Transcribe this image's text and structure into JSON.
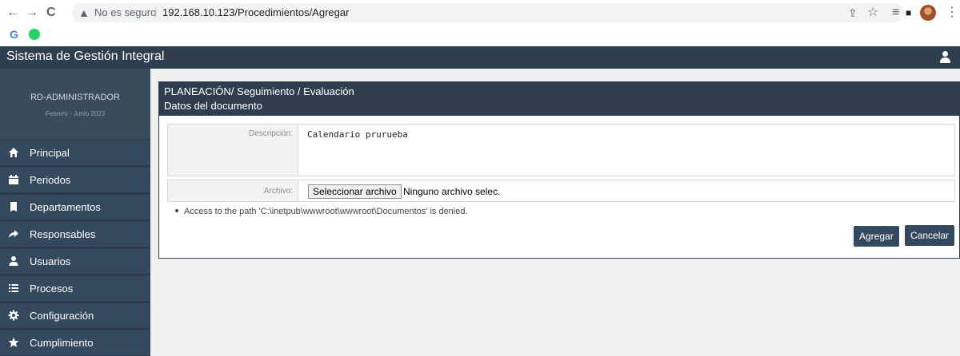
{
  "browser": {
    "secure_text": "No es seguro",
    "separator": "|",
    "url": "192.168.10.123/Procedimientos/Agregar",
    "back_glyph": "←",
    "forward_glyph": "→",
    "reload_glyph": "C",
    "warning_glyph": "▲",
    "share_glyph": "⇪",
    "star_glyph": "☆",
    "readinglist_glyph": "≡",
    "window_glyph": "■",
    "menu_glyph": "⋮",
    "bookmark_google": "G"
  },
  "app": {
    "title": "Sistema de Gestión Integral"
  },
  "profile": {
    "name": "RD-ADMINISTRADOR",
    "period": "Febrero - Junio 2023"
  },
  "sidebar": {
    "items": [
      {
        "label": "Principal",
        "icon": "home-icon"
      },
      {
        "label": "Periodos",
        "icon": "calendar-icon"
      },
      {
        "label": "Departamentos",
        "icon": "book-icon"
      },
      {
        "label": "Responsables",
        "icon": "share-icon"
      },
      {
        "label": "Usuarios",
        "icon": "user-icon"
      },
      {
        "label": "Procesos",
        "icon": "list-icon"
      },
      {
        "label": "Configuración",
        "icon": "gear-icon"
      },
      {
        "label": "Cumplimiento",
        "icon": "star-icon"
      }
    ]
  },
  "panel": {
    "breadcrumb": "PLANEACIÓN/ Seguimiento / Evaluación",
    "title": "Datos del documento",
    "description_label": "Descripción:",
    "description_value": "Calendario prurueba",
    "file_label": "Archivo:",
    "file_button": "Seleccionar archivo",
    "file_status": "Ninguno archivo selec.",
    "error_message": "Access to the path 'C:\\inetpub\\wwwroot\\wwwroot\\Documentos' is denied.",
    "add_button": "Agregar",
    "cancel_button": "Cancelar"
  },
  "colors": {
    "primary_dark": "#2f3e4e",
    "sidebar_item": "#34495e"
  }
}
